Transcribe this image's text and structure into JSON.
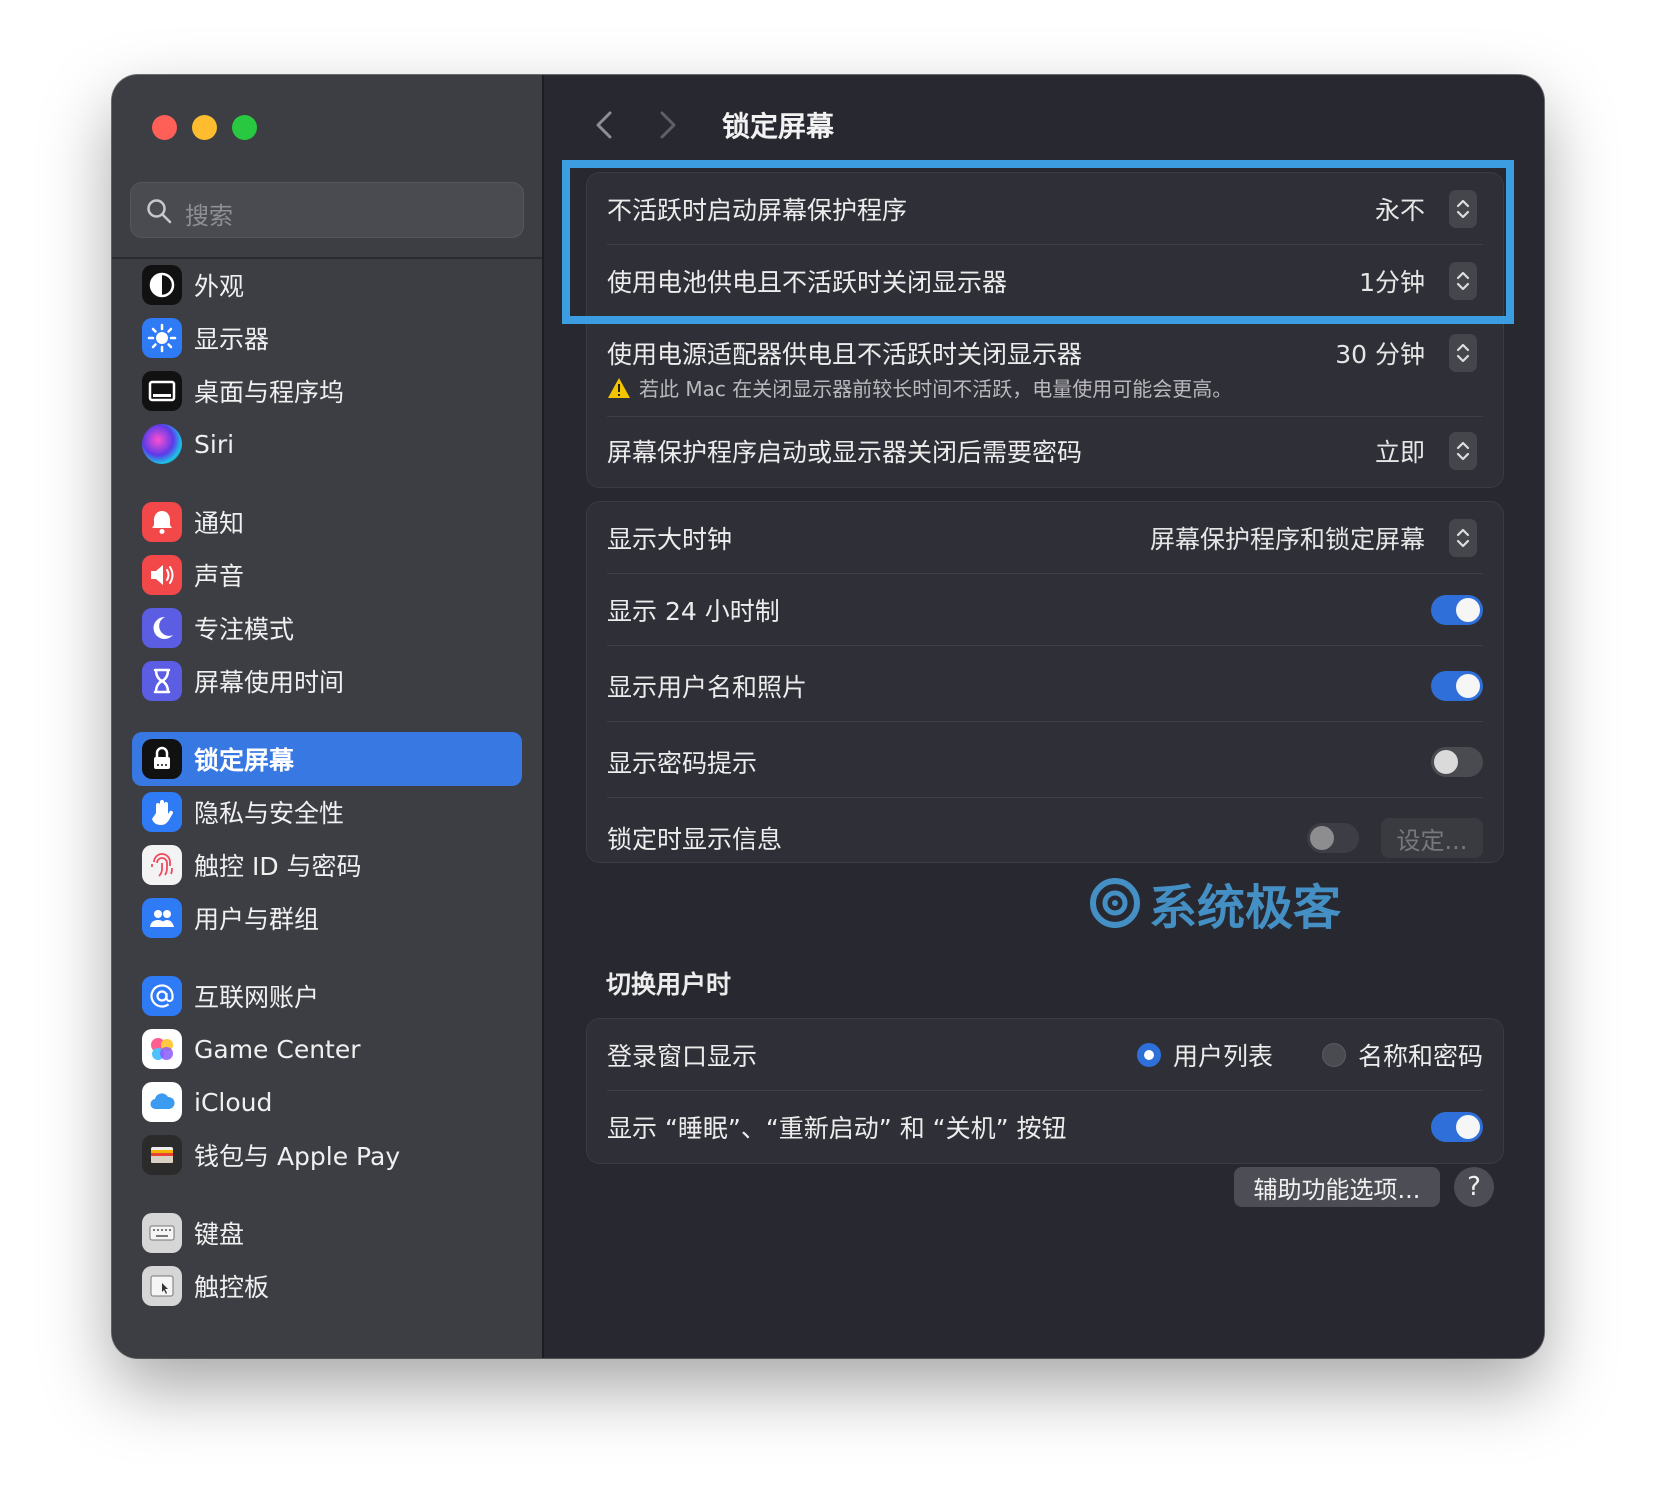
{
  "sidebar": {
    "search_placeholder": "搜索",
    "items": [
      {
        "label": "外观",
        "icon": "appearance-icon",
        "color": "#111111"
      },
      {
        "label": "显示器",
        "icon": "display-brightness-icon",
        "color": "#2f7bf6"
      },
      {
        "label": "桌面与程序坞",
        "icon": "dock-icon",
        "color": "#111111"
      },
      {
        "label": "Siri",
        "icon": "siri-icon",
        "color": "#222222"
      },
      {
        "label": "通知",
        "icon": "bell-icon",
        "color": "#f2484a"
      },
      {
        "label": "声音",
        "icon": "speaker-icon",
        "color": "#f2484a"
      },
      {
        "label": "专注模式",
        "icon": "moon-icon",
        "color": "#5b5de3"
      },
      {
        "label": "屏幕使用时间",
        "icon": "hourglass-icon",
        "color": "#5b5de3"
      },
      {
        "label": "锁定屏幕",
        "icon": "lock-icon",
        "color": "#111111"
      },
      {
        "label": "隐私与安全性",
        "icon": "hand-icon",
        "color": "#2f7bf6"
      },
      {
        "label": "触控 ID 与密码",
        "icon": "fingerprint-icon",
        "color": "#f3f3f3"
      },
      {
        "label": "用户与群组",
        "icon": "users-icon",
        "color": "#2f7bf6"
      },
      {
        "label": "互联网账户",
        "icon": "at-sign-icon",
        "color": "#2f7bf6"
      },
      {
        "label": "Game Center",
        "icon": "game-center-icon",
        "color": "#ffffff"
      },
      {
        "label": "iCloud",
        "icon": "cloud-icon",
        "color": "#ffffff"
      },
      {
        "label": "钱包与 Apple Pay",
        "icon": "wallet-icon",
        "color": "#2b2b2b"
      },
      {
        "label": "键盘",
        "icon": "keyboard-icon",
        "color": "#d6d6d6"
      },
      {
        "label": "触控板",
        "icon": "trackpad-icon",
        "color": "#d6d6d6"
      }
    ],
    "active_item": "锁定屏幕"
  },
  "header": {
    "title": "锁定屏幕"
  },
  "group1": {
    "screensaver": {
      "label": "不活跃时启动屏幕保护程序",
      "value": "永不"
    },
    "battery_display_off": {
      "label": "使用电池供电且不活跃时关闭显示器",
      "value": "1分钟"
    },
    "adapter_display_off": {
      "label": "使用电源适配器供电且不活跃时关闭显示器",
      "value": "30 分钟",
      "warning": "若此 Mac 在关闭显示器前较长时间不活跃，电量使用可能会更高。"
    },
    "require_password": {
      "label": "屏幕保护程序启动或显示器关闭后需要密码",
      "value": "立即"
    }
  },
  "group2": {
    "big_clock": {
      "label": "显示大时钟",
      "value": "屏幕保护程序和锁定屏幕"
    },
    "clock_24h": {
      "label": "显示 24 小时制",
      "on": true
    },
    "show_user_photo": {
      "label": "显示用户名和照片",
      "on": true
    },
    "password_hint": {
      "label": "显示密码提示",
      "on": false
    },
    "lock_message": {
      "label": "锁定时显示信息",
      "on": false,
      "button": "设定..."
    }
  },
  "switch_user": {
    "heading": "切换用户时",
    "login_window": {
      "label": "登录窗口显示",
      "options": [
        "用户列表",
        "名称和密码"
      ],
      "selected": "用户列表"
    },
    "power_buttons": {
      "label": "显示 “睡眠”、“重新启动” 和 “关机” 按钮",
      "on": true
    }
  },
  "footer": {
    "accessibility_button": "辅助功能选项...",
    "help": "?"
  },
  "watermark": "系统极客",
  "colors": {
    "accent": "#2e6fd9",
    "selection": "#3778e3",
    "highlight_frame": "#3c9ee0"
  }
}
